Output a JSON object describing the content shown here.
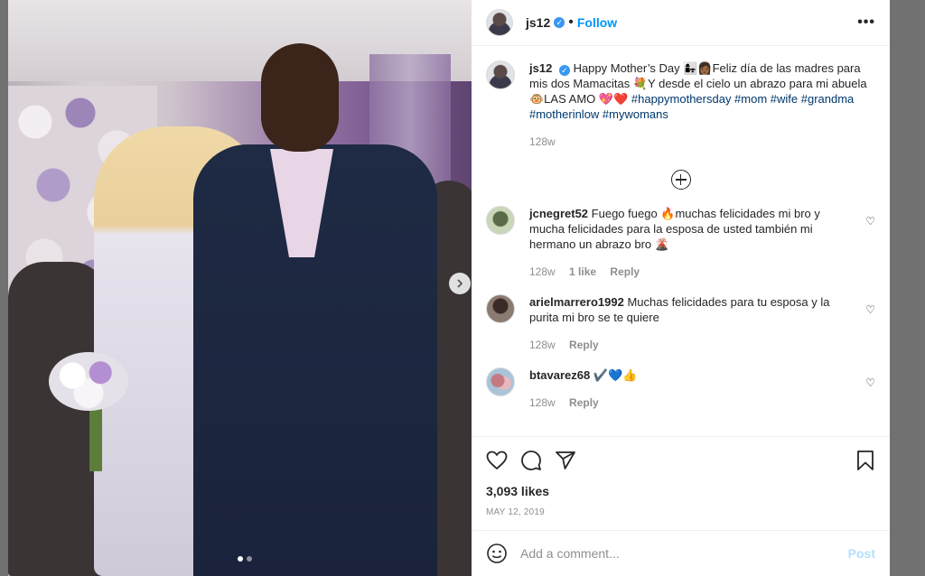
{
  "header": {
    "username": "js12",
    "separator": "•",
    "follow_label": "Follow",
    "more_label": "•••"
  },
  "caption": {
    "username": "js12",
    "text_1": "Happy Mother’s Day 👩‍👧👩🏾Feliz día de las madres para mis dos Mamacitas 💐Y desde el cielo un abrazo para mi abuela 🐵LAS AMO 💖❤️",
    "hashtags": "#happymothersday #mom #wife #grandma #motherinlow #mywomans",
    "time": "128w"
  },
  "comments": [
    {
      "username": "jcnegret52",
      "text": "Fuego fuego 🔥muchas felicidades mi bro y mucha felicidades para la esposa de usted también mi hermano un abrazo bro 🌋",
      "time": "128w",
      "likes": "1 like",
      "reply": "Reply"
    },
    {
      "username": "arielmarrero1992",
      "text": "Muchas felicidades para tu esposa y la purita mi bro se te quiere",
      "time": "128w",
      "reply": "Reply"
    },
    {
      "username": "btavarez68",
      "text": "✔️💙👍",
      "time": "128w",
      "reply": "Reply"
    }
  ],
  "actions": {
    "likes": "3,093 likes",
    "date": "MAY 12, 2019"
  },
  "add_comment": {
    "placeholder": "Add a comment...",
    "post_label": "Post"
  },
  "icons": {
    "verified": "verified-icon",
    "like": "heart-icon",
    "comment": "comment-icon",
    "share": "send-icon",
    "save": "bookmark-icon",
    "emoji": "smiley-icon",
    "load_more": "plus-circle-icon",
    "next": "chevron-right-icon"
  },
  "colors": {
    "accent": "#0095f6",
    "hashtag": "#00376b",
    "muted": "#8e8e8e",
    "post_disabled": "#b2dffc"
  }
}
